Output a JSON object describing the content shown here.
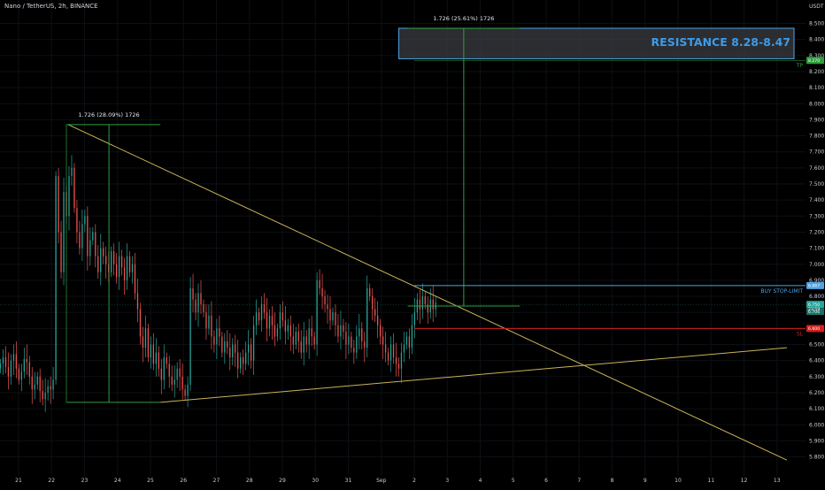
{
  "header": {
    "symbol_text": "Nano / TetherUS, 2h, BINANCE"
  },
  "colors": {
    "background": "#000000",
    "candle_up": "#26a69a",
    "candle_down": "#ef5350",
    "trendline": "#c9b458",
    "measure": "#2e9e3c",
    "buy_stop": "#4fa3e3",
    "stop_loss": "#d41e1e",
    "take_profit": "#2e9e3c",
    "resistance_text": "#3d9be9"
  },
  "chart_data": {
    "type": "candlestick",
    "title": "",
    "xlabel": "",
    "ylabel": "",
    "y_unit": "USDT",
    "ylim": [
      5.74,
      8.62
    ],
    "y_ticks": [
      5.8,
      5.9,
      6.0,
      6.1,
      6.2,
      6.3,
      6.4,
      6.5,
      6.6,
      6.7,
      6.8,
      6.9,
      7.0,
      7.1,
      7.2,
      7.3,
      7.4,
      7.5,
      7.6,
      7.7,
      7.8,
      7.9,
      8.0,
      8.1,
      8.2,
      8.3,
      8.4,
      8.5
    ],
    "y_tick_labels": [
      "5.800",
      "5.900",
      "6.000",
      "6.100",
      "6.200",
      "6.300",
      "6.400",
      "6.500",
      "6.600",
      "6.700",
      "6.800",
      "6.900",
      "7.000",
      "7.100",
      "7.200",
      "7.300",
      "7.400",
      "7.500",
      "7.600",
      "7.700",
      "7.800",
      "7.900",
      "8.000",
      "8.100",
      "8.200",
      "8.300",
      "8.400",
      "8.500"
    ],
    "x_range_days": [
      20.5,
      44.3
    ],
    "x_ticks": [
      {
        "day": 21,
        "label": "21"
      },
      {
        "day": 22,
        "label": "22"
      },
      {
        "day": 23,
        "label": "23"
      },
      {
        "day": 24,
        "label": "24"
      },
      {
        "day": 25,
        "label": "25"
      },
      {
        "day": 26,
        "label": "26"
      },
      {
        "day": 27,
        "label": "27"
      },
      {
        "day": 28,
        "label": "28"
      },
      {
        "day": 29,
        "label": "29"
      },
      {
        "day": 30,
        "label": "30"
      },
      {
        "day": 31,
        "label": "31"
      },
      {
        "day": 32,
        "label": "Sep"
      },
      {
        "day": 33,
        "label": "2"
      },
      {
        "day": 34,
        "label": "3"
      },
      {
        "day": 35,
        "label": "4"
      },
      {
        "day": 36,
        "label": "5"
      },
      {
        "day": 37,
        "label": "6"
      },
      {
        "day": 38,
        "label": "7"
      },
      {
        "day": 39,
        "label": "8"
      },
      {
        "day": 40,
        "label": "9"
      },
      {
        "day": 41,
        "label": "10"
      },
      {
        "day": 42,
        "label": "11"
      },
      {
        "day": 43,
        "label": "12"
      },
      {
        "day": 44,
        "label": "13"
      }
    ],
    "candles_close": [
      6.38,
      6.42,
      6.36,
      6.3,
      6.4,
      6.44,
      6.35,
      6.28,
      6.33,
      6.41,
      6.39,
      6.3,
      6.22,
      6.25,
      6.3,
      6.21,
      6.16,
      6.2,
      6.24,
      6.22,
      6.28,
      7.55,
      7.2,
      6.95,
      7.45,
      7.3,
      7.55,
      7.6,
      7.35,
      7.2,
      7.1,
      7.25,
      7.3,
      7.05,
      7.15,
      7.2,
      7.05,
      6.95,
      7.1,
      7.05,
      7.0,
      6.95,
      7.08,
      7.0,
      6.92,
      7.05,
      6.98,
      6.9,
      7.05,
      6.95,
      7.0,
      6.82,
      6.72,
      6.55,
      6.48,
      6.6,
      6.42,
      6.5,
      6.38,
      6.45,
      6.35,
      6.28,
      6.42,
      6.38,
      6.3,
      6.25,
      6.28,
      6.35,
      6.3,
      6.22,
      6.18,
      6.25,
      6.85,
      6.78,
      6.7,
      6.82,
      6.75,
      6.7,
      6.6,
      6.68,
      6.55,
      6.5,
      6.6,
      6.55,
      6.45,
      6.52,
      6.48,
      6.42,
      6.5,
      6.45,
      6.35,
      6.42,
      6.38,
      6.45,
      6.5,
      6.4,
      6.62,
      6.7,
      6.65,
      6.75,
      6.7,
      6.6,
      6.68,
      6.62,
      6.55,
      6.6,
      6.7,
      6.65,
      6.58,
      6.62,
      6.55,
      6.5,
      6.58,
      6.52,
      6.45,
      6.55,
      6.5,
      6.6,
      6.55,
      6.5,
      6.9,
      6.85,
      6.8,
      6.75,
      6.72,
      6.65,
      6.7,
      6.62,
      6.55,
      6.62,
      6.58,
      6.5,
      6.55,
      6.48,
      6.45,
      6.55,
      6.6,
      6.52,
      6.48,
      6.85,
      6.8,
      6.72,
      6.68,
      6.62,
      6.55,
      6.5,
      6.45,
      6.4,
      6.5,
      6.42,
      6.38,
      6.35,
      6.45,
      6.5,
      6.55,
      6.48,
      6.62,
      6.7,
      6.78,
      6.72,
      6.8,
      6.75,
      6.7,
      6.78,
      6.72,
      6.76
    ],
    "levels": {
      "buy_stop_limit": {
        "value": 6.867,
        "label": "BUY STOP-LIMIT",
        "badge": "6.867"
      },
      "stop_loss": {
        "value": 6.6,
        "label": "SL",
        "badge": "6.600"
      },
      "take_profit": {
        "value": 8.27,
        "label": "TP",
        "badge": "8.270"
      },
      "current_price": {
        "value": 6.75,
        "badge": "6.750",
        "countdown": "23:59"
      },
      "last_badge": {
        "value": 6.706,
        "badge": "6.706"
      }
    },
    "resistance_zone": {
      "low": 8.28,
      "high": 8.47,
      "label": "RESISTANCE 8.28-8.47"
    },
    "measure_left": {
      "label": "1.726 (28.09%) 1726",
      "low": 6.14,
      "high": 7.87,
      "x_start_day": 22.45,
      "x_end_day": 25.3
    },
    "measure_right": {
      "label": "1.726 (25.61%) 1726",
      "low": 6.74,
      "high": 8.47,
      "x_start_day": 32.8,
      "x_end_day": 36.2
    },
    "trendlines": [
      {
        "name": "descending",
        "x1_day": 22.5,
        "y1": 7.87,
        "x2_day": 44.3,
        "y2": 5.78
      },
      {
        "name": "ascending",
        "x1_day": 25.3,
        "y1": 6.14,
        "x2_day": 44.3,
        "y2": 6.48
      }
    ]
  }
}
